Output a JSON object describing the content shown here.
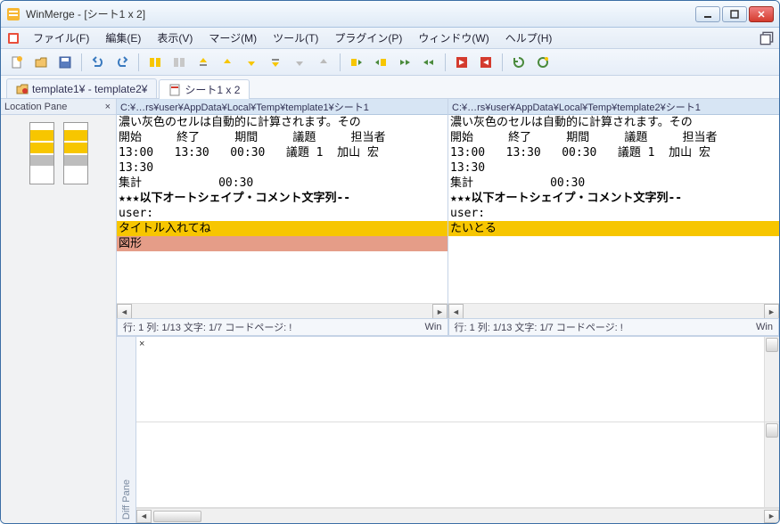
{
  "window": {
    "title": "WinMerge - [シート1 x 2]"
  },
  "menu": {
    "file": "ファイル(F)",
    "edit": "編集(E)",
    "view": "表示(V)",
    "merge": "マージ(M)",
    "tools": "ツール(T)",
    "plugins": "プラグイン(P)",
    "window": "ウィンドウ(W)",
    "help": "ヘルプ(H)"
  },
  "tabs": {
    "t1": "template1¥ - template2¥",
    "t2": "シート1 x 2"
  },
  "location_pane": {
    "title": "Location Pane"
  },
  "pane_left": {
    "path": "C:¥…rs¥user¥AppData¥Local¥Temp¥template1¥シート1",
    "lines": [
      "濃い灰色のセルは自動的に計算されます。その",
      "開始     終了     期間     議題     担当者",
      "13:00   13:30   00:30   議題 1  加山 宏",
      "13:30",
      "集計           00:30",
      "★★★以下オートシェイプ・コメント文字列--",
      "user:",
      "タイトル入れてね",
      "図形"
    ],
    "status": "行: 1  列: 1/13  文字: 1/7  コードページ: !",
    "encoding": "Win"
  },
  "pane_right": {
    "path": "C:¥…rs¥user¥AppData¥Local¥Temp¥template2¥シート1",
    "lines": [
      "濃い灰色のセルは自動的に計算されます。その",
      "開始     終了     期間     議題     担当者",
      "13:00   13:30   00:30   議題 1  加山 宏",
      "13:30",
      "集計           00:30",
      "★★★以下オートシェイプ・コメント文字列--",
      "user:",
      "たいとる",
      ""
    ],
    "status": "行: 1  列: 1/13  文字: 1/7  コードページ: !",
    "encoding": "Win"
  },
  "diff_pane": {
    "label": "Diff Pane"
  }
}
